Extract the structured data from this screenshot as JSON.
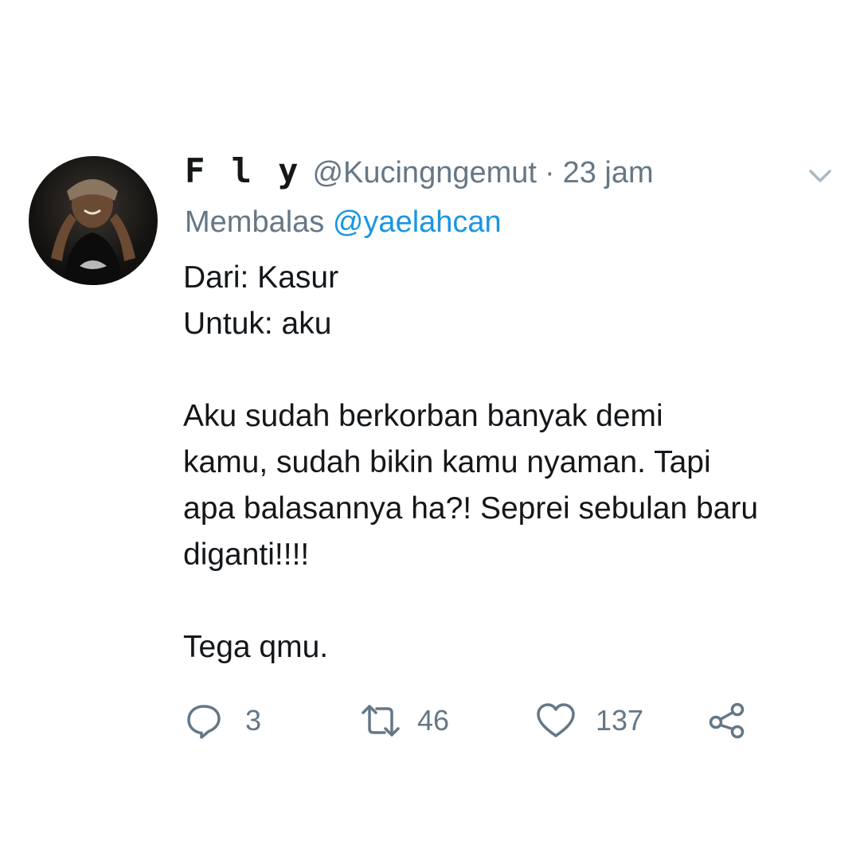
{
  "tweet": {
    "display_name": "F l y",
    "handle": "@Kucingngemut",
    "separator": "·",
    "time": "23 jam",
    "reply_prefix": "Membalas",
    "reply_to": "@yaelahcan",
    "body_lines": [
      "Dari: Kasur",
      "Untuk: aku",
      "",
      "Aku sudah berkorban banyak demi",
      "kamu, sudah bikin kamu nyaman. Tapi",
      "apa balasannya ha?! Seprei sebulan baru",
      "diganti!!!!",
      "",
      "Tega qmu."
    ]
  },
  "actions": {
    "reply_icon": "reply-icon",
    "reply_count": "3",
    "retweet_icon": "retweet-icon",
    "retweet_count": "46",
    "like_icon": "heart-icon",
    "like_count": "137",
    "share_icon": "share-icon"
  },
  "colors": {
    "text": "#14171a",
    "muted": "#657786",
    "link": "#1b95e0",
    "background": "#ffffff"
  }
}
